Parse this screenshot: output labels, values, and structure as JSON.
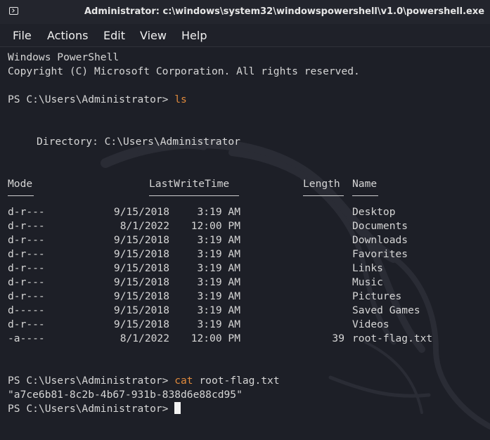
{
  "window": {
    "title": "Administrator: c:\\windows\\system32\\windowspowershell\\v1.0\\powershell.exe",
    "icon": "terminal-icon"
  },
  "menu": [
    "File",
    "Actions",
    "Edit",
    "View",
    "Help"
  ],
  "terminal": {
    "banner_line1": "Windows PowerShell",
    "banner_line2": "Copyright (C) Microsoft Corporation. All rights reserved.",
    "prompt": "PS C:\\Users\\Administrator> ",
    "command1": "ls",
    "directory_line": "Directory: C:\\Users\\Administrator",
    "headers": {
      "mode": "Mode",
      "lastwritetime": "LastWriteTime",
      "length": "Length",
      "name": "Name"
    },
    "rows": [
      {
        "mode": "d-r---",
        "date": "9/15/2018",
        "time": "3:19 AM",
        "length": "",
        "name": "Desktop"
      },
      {
        "mode": "d-r---",
        "date": "8/1/2022",
        "time": "12:00 PM",
        "length": "",
        "name": "Documents"
      },
      {
        "mode": "d-r---",
        "date": "9/15/2018",
        "time": "3:19 AM",
        "length": "",
        "name": "Downloads"
      },
      {
        "mode": "d-r---",
        "date": "9/15/2018",
        "time": "3:19 AM",
        "length": "",
        "name": "Favorites"
      },
      {
        "mode": "d-r---",
        "date": "9/15/2018",
        "time": "3:19 AM",
        "length": "",
        "name": "Links"
      },
      {
        "mode": "d-r---",
        "date": "9/15/2018",
        "time": "3:19 AM",
        "length": "",
        "name": "Music"
      },
      {
        "mode": "d-r---",
        "date": "9/15/2018",
        "time": "3:19 AM",
        "length": "",
        "name": "Pictures"
      },
      {
        "mode": "d-----",
        "date": "9/15/2018",
        "time": "3:19 AM",
        "length": "",
        "name": "Saved Games"
      },
      {
        "mode": "d-r---",
        "date": "9/15/2018",
        "time": "3:19 AM",
        "length": "",
        "name": "Videos"
      },
      {
        "mode": "-a----",
        "date": "8/1/2022",
        "time": "12:00 PM",
        "length": "39",
        "name": "root-flag.txt"
      }
    ],
    "command2_verb": "cat",
    "command2_arg": " root-flag.txt",
    "flag_output": "\"a7ce6b81-8c2b-4b67-931b-838d6e88cd95\""
  },
  "colors": {
    "background": "#1d1f27",
    "titlebar": "#23252d",
    "text": "#d6d6d6",
    "command": "#e08a3c"
  }
}
